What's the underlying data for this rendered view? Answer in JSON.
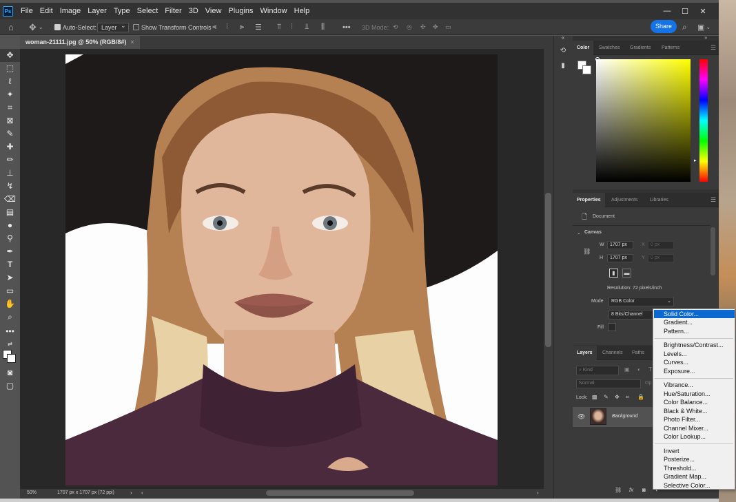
{
  "app": {
    "logo_text": "Ps"
  },
  "menubar": {
    "items": [
      "File",
      "Edit",
      "Image",
      "Layer",
      "Type",
      "Select",
      "Filter",
      "3D",
      "View",
      "Plugins",
      "Window",
      "Help"
    ],
    "window_controls": [
      "—",
      "☐",
      "✕"
    ]
  },
  "options_bar": {
    "auto_select_label": "Auto-Select:",
    "auto_select_checked": true,
    "auto_select_target": "Layer",
    "show_transform_label": "Show Transform Controls",
    "show_transform_checked": false,
    "mode_3d_label": "3D Mode:",
    "share_label": "Share"
  },
  "document": {
    "tab_title": "woman-21111.jpg @ 50% (RGB/8#)",
    "close_glyph": "×"
  },
  "status_bar": {
    "zoom": "50%",
    "dimensions": "1707 px x 1707 px (72 ppi)"
  },
  "color_panel": {
    "tabs": [
      "Color",
      "Swatches",
      "Gradients",
      "Patterns"
    ],
    "active_tab": "Color",
    "foreground": "#ffffff",
    "background": "#ffffff",
    "hue_color": "#ffff00"
  },
  "properties_panel": {
    "tabs": [
      "Properties",
      "Adjustments",
      "Libraries"
    ],
    "active_tab": "Properties",
    "document_label": "Document",
    "canvas_section": "Canvas",
    "w_label": "W",
    "w_value": "1707 px",
    "h_label": "H",
    "h_value": "1707 px",
    "x_label": "X",
    "x_placeholder": "0 px",
    "y_label": "Y",
    "y_placeholder": "0 px",
    "resolution": "Resolution: 72 pixels/inch",
    "mode_label": "Mode",
    "mode_value": "RGB Color",
    "bits_value": "8 Bits/Channel",
    "fill_label": "Fill"
  },
  "layers_panel": {
    "tabs": [
      "Layers",
      "Channels",
      "Paths"
    ],
    "active_tab": "Layers",
    "kind_placeholder": "Kind",
    "blend_mode": "Normal",
    "opacity_label": "Op",
    "lock_label": "Lock:",
    "layer_name": "Background"
  },
  "adjustment_menu": {
    "groups": [
      [
        "Solid Color...",
        "Gradient...",
        "Pattern..."
      ],
      [
        "Brightness/Contrast...",
        "Levels...",
        "Curves...",
        "Exposure..."
      ],
      [
        "Vibrance...",
        "Hue/Saturation...",
        "Color Balance...",
        "Black & White...",
        "Photo Filter...",
        "Channel Mixer...",
        "Color Lookup..."
      ],
      [
        "Invert",
        "Posterize...",
        "Threshold...",
        "Gradient Map...",
        "Selective Color..."
      ]
    ],
    "selected": "Solid Color...",
    "selected_color": "#0b68d0"
  },
  "tools": [
    "move-tool",
    "marquee-tool",
    "lasso-tool",
    "magic-wand-tool",
    "crop-tool",
    "frame-tool",
    "eyedropper-tool",
    "healing-tool",
    "brush-tool",
    "stamp-tool",
    "history-brush-tool",
    "eraser-tool",
    "gradient-tool",
    "blur-tool",
    "dodge-tool",
    "pen-tool",
    "type-tool",
    "path-select-tool",
    "shape-tool",
    "hand-tool",
    "zoom-tool",
    "more-tools"
  ]
}
